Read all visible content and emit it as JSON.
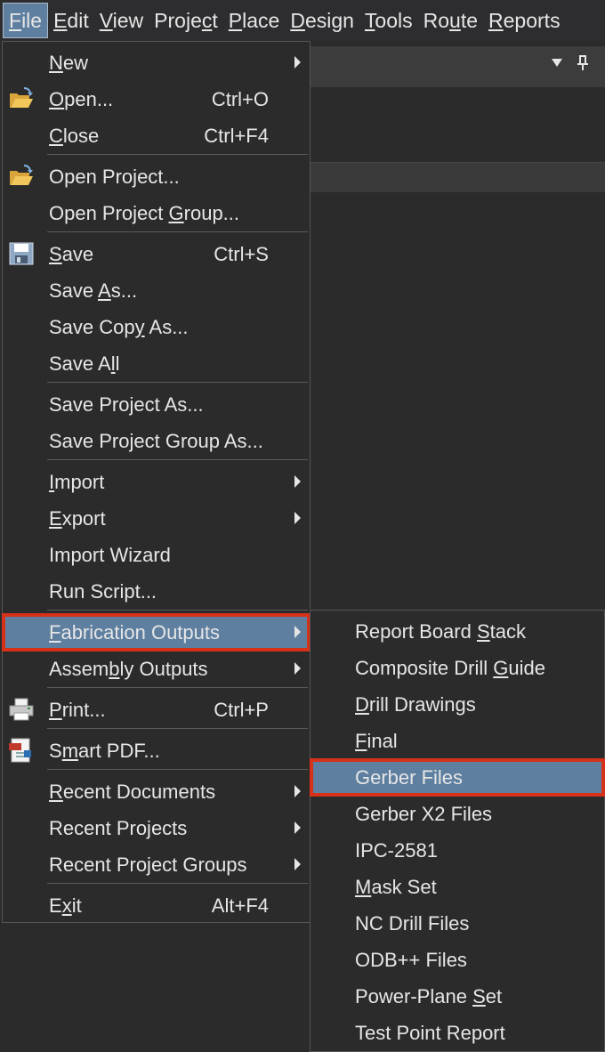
{
  "menubar": {
    "items": [
      {
        "label": "File",
        "mnemonic": "F"
      },
      {
        "label": "Edit",
        "mnemonic": "E"
      },
      {
        "label": "View",
        "mnemonic": "V"
      },
      {
        "label": "Project",
        "mnemonic": "c"
      },
      {
        "label": "Place",
        "mnemonic": "P"
      },
      {
        "label": "Design",
        "mnemonic": "D"
      },
      {
        "label": "Tools",
        "mnemonic": "T"
      },
      {
        "label": "Route",
        "mnemonic": "u"
      },
      {
        "label": "Reports",
        "mnemonic": "R"
      }
    ],
    "active": "File"
  },
  "panel": {
    "dropdown_icon": "triangle-down-icon",
    "pin_icon": "pin-icon"
  },
  "file_menu": {
    "items": [
      {
        "label": "New",
        "mnemonic": "N",
        "shortcut": "",
        "submenu": true,
        "icon": ""
      },
      {
        "label": "Open...",
        "mnemonic": "O",
        "shortcut": "Ctrl+O",
        "submenu": false,
        "icon": "open-folder-icon"
      },
      {
        "label": "Close",
        "mnemonic": "C",
        "shortcut": "Ctrl+F4",
        "submenu": false,
        "icon": ""
      },
      {
        "label": "Open Project...",
        "mnemonic": "j",
        "shortcut": "",
        "submenu": false,
        "icon": "open-project-icon"
      },
      {
        "label": "Open Project Group...",
        "mnemonic": "G",
        "shortcut": "",
        "submenu": false,
        "icon": ""
      },
      {
        "label": "Save",
        "mnemonic": "S",
        "shortcut": "Ctrl+S",
        "submenu": false,
        "icon": "save-disk-icon"
      },
      {
        "label": "Save As...",
        "mnemonic": "A",
        "shortcut": "",
        "submenu": false,
        "icon": ""
      },
      {
        "label": "Save Copy As...",
        "mnemonic": "y",
        "shortcut": "",
        "submenu": false,
        "icon": ""
      },
      {
        "label": "Save All",
        "mnemonic": "l",
        "shortcut": "",
        "submenu": false,
        "icon": ""
      },
      {
        "label": "Save Project As...",
        "mnemonic": "",
        "shortcut": "",
        "submenu": false,
        "icon": ""
      },
      {
        "label": "Save Project Group As...",
        "mnemonic": "",
        "shortcut": "",
        "submenu": false,
        "icon": ""
      },
      {
        "label": "Import",
        "mnemonic": "I",
        "shortcut": "",
        "submenu": true,
        "icon": ""
      },
      {
        "label": "Export",
        "mnemonic": "E",
        "shortcut": "",
        "submenu": true,
        "icon": ""
      },
      {
        "label": "Import Wizard",
        "mnemonic": "",
        "shortcut": "",
        "submenu": false,
        "icon": ""
      },
      {
        "label": "Run Script...",
        "mnemonic": "",
        "shortcut": "",
        "submenu": false,
        "icon": ""
      },
      {
        "label": "Fabrication Outputs",
        "mnemonic": "F",
        "shortcut": "",
        "submenu": true,
        "icon": "",
        "highlighted": true
      },
      {
        "label": "Assembly Outputs",
        "mnemonic": "b",
        "shortcut": "",
        "submenu": true,
        "icon": ""
      },
      {
        "label": "Print...",
        "mnemonic": "P",
        "shortcut": "Ctrl+P",
        "submenu": false,
        "icon": "printer-icon"
      },
      {
        "label": "Smart PDF...",
        "mnemonic": "m",
        "shortcut": "",
        "submenu": false,
        "icon": "smart-pdf-icon"
      },
      {
        "label": "Recent Documents",
        "mnemonic": "R",
        "shortcut": "",
        "submenu": true,
        "icon": ""
      },
      {
        "label": "Recent Projects",
        "mnemonic": "",
        "shortcut": "",
        "submenu": true,
        "icon": ""
      },
      {
        "label": "Recent Project Groups",
        "mnemonic": "",
        "shortcut": "",
        "submenu": true,
        "icon": ""
      },
      {
        "label": "Exit",
        "mnemonic": "x",
        "shortcut": "Alt+F4",
        "submenu": false,
        "icon": ""
      }
    ]
  },
  "fabrication_submenu": {
    "items": [
      {
        "label": "Report Board Stack",
        "mnemonic": "S"
      },
      {
        "label": "Composite Drill Guide",
        "mnemonic": "G"
      },
      {
        "label": "Drill Drawings",
        "mnemonic": "D"
      },
      {
        "label": "Final",
        "mnemonic": "F"
      },
      {
        "label": "Gerber Files",
        "mnemonic": "",
        "highlighted": true
      },
      {
        "label": "Gerber X2 Files",
        "mnemonic": ""
      },
      {
        "label": "IPC-2581",
        "mnemonic": ""
      },
      {
        "label": "Mask Set",
        "mnemonic": "M"
      },
      {
        "label": "NC Drill Files",
        "mnemonic": ""
      },
      {
        "label": "ODB++ Files",
        "mnemonic": ""
      },
      {
        "label": "Power-Plane Set",
        "mnemonic": "S"
      },
      {
        "label": "Test Point Report",
        "mnemonic": ""
      }
    ]
  },
  "colors": {
    "background": "#2b2b2b",
    "highlight": "#5e7fa0",
    "outline": "#d8311a",
    "text": "#e6e6e6"
  }
}
